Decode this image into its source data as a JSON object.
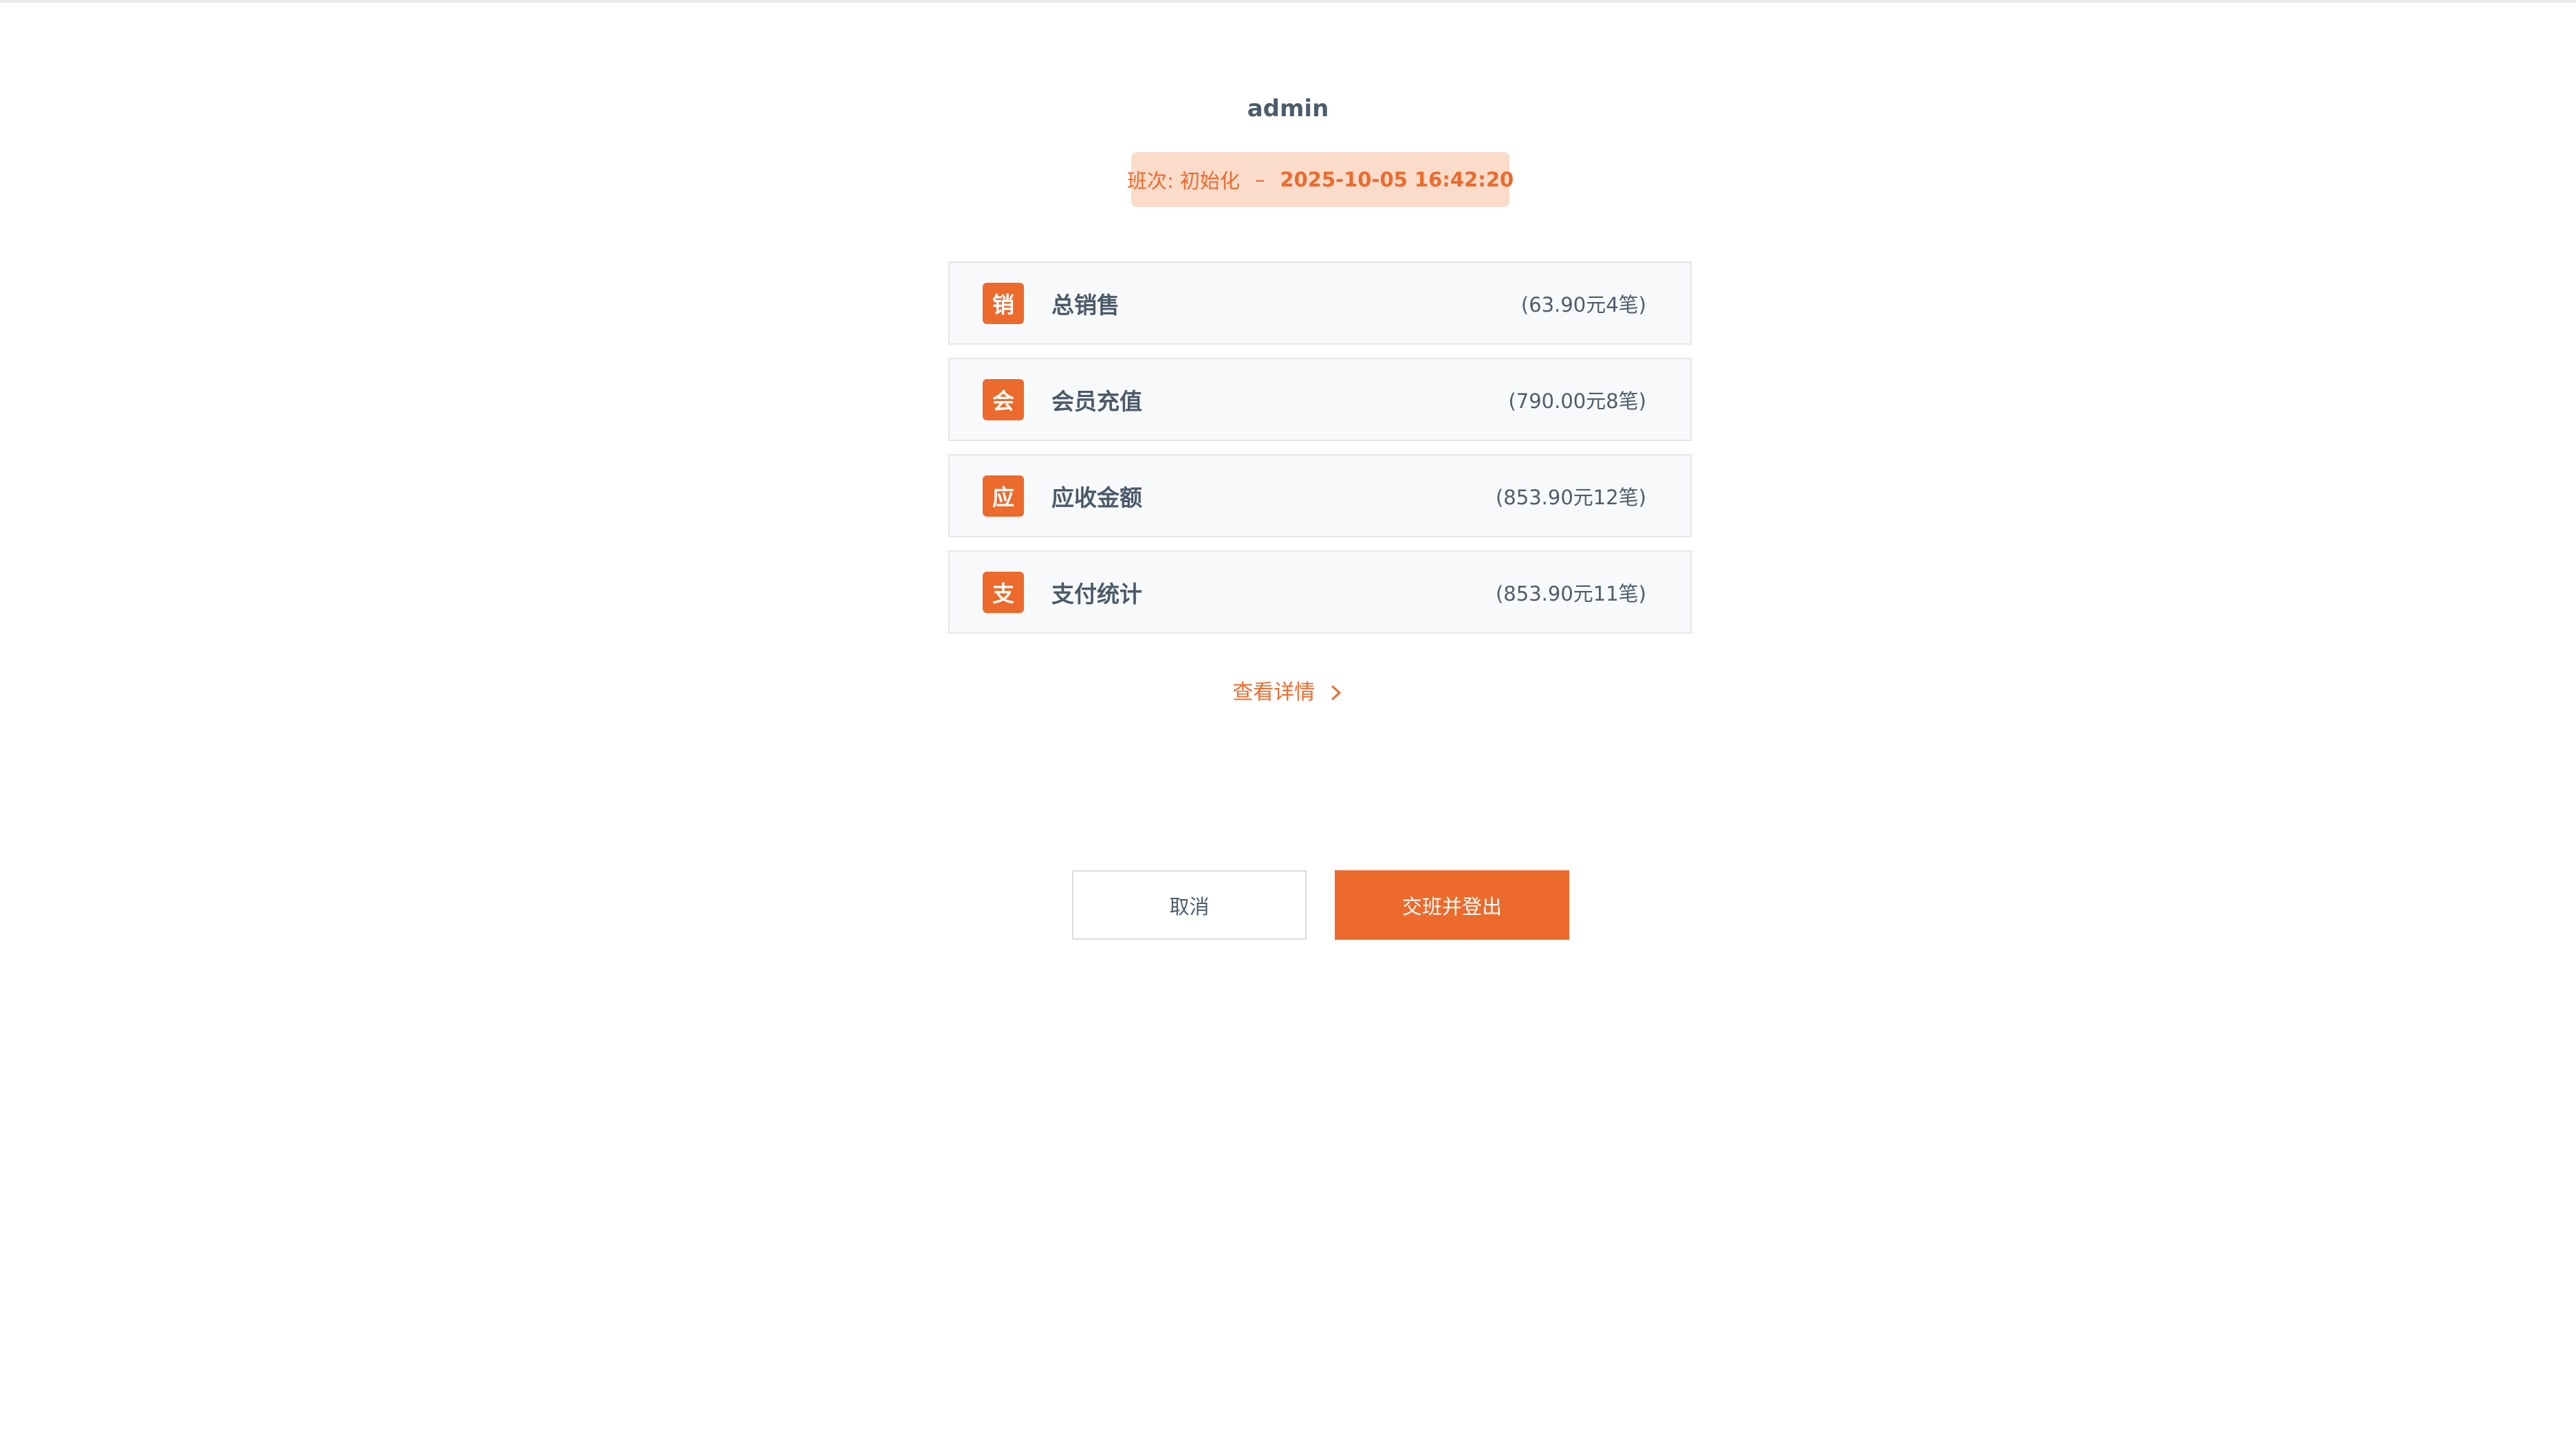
{
  "header": {
    "username": "admin"
  },
  "shift": {
    "label": "班次: 初始化",
    "separator": "–",
    "time": "2025-10-05 16:42:20"
  },
  "summary": {
    "rows": [
      {
        "icon_text": "销",
        "label": "总销售",
        "value": "(63.90元4笔)"
      },
      {
        "icon_text": "会",
        "label": "会员充值",
        "value": "(790.00元8笔)"
      },
      {
        "icon_text": "应",
        "label": "应收金额",
        "value": "(853.90元12笔)"
      },
      {
        "icon_text": "支",
        "label": "支付统计",
        "value": "(853.90元11笔)"
      }
    ]
  },
  "details": {
    "label": "查看详情",
    "icon": "chevron-right-icon"
  },
  "actions": {
    "cancel_label": "取消",
    "confirm_label": "交班并登出"
  },
  "colors": {
    "accent": "#ec6a2c",
    "badge_bg": "#fbdccb",
    "row_bg": "#f8f9fa",
    "row_border": "#e3e6e9",
    "text": "#4a5a6a"
  }
}
